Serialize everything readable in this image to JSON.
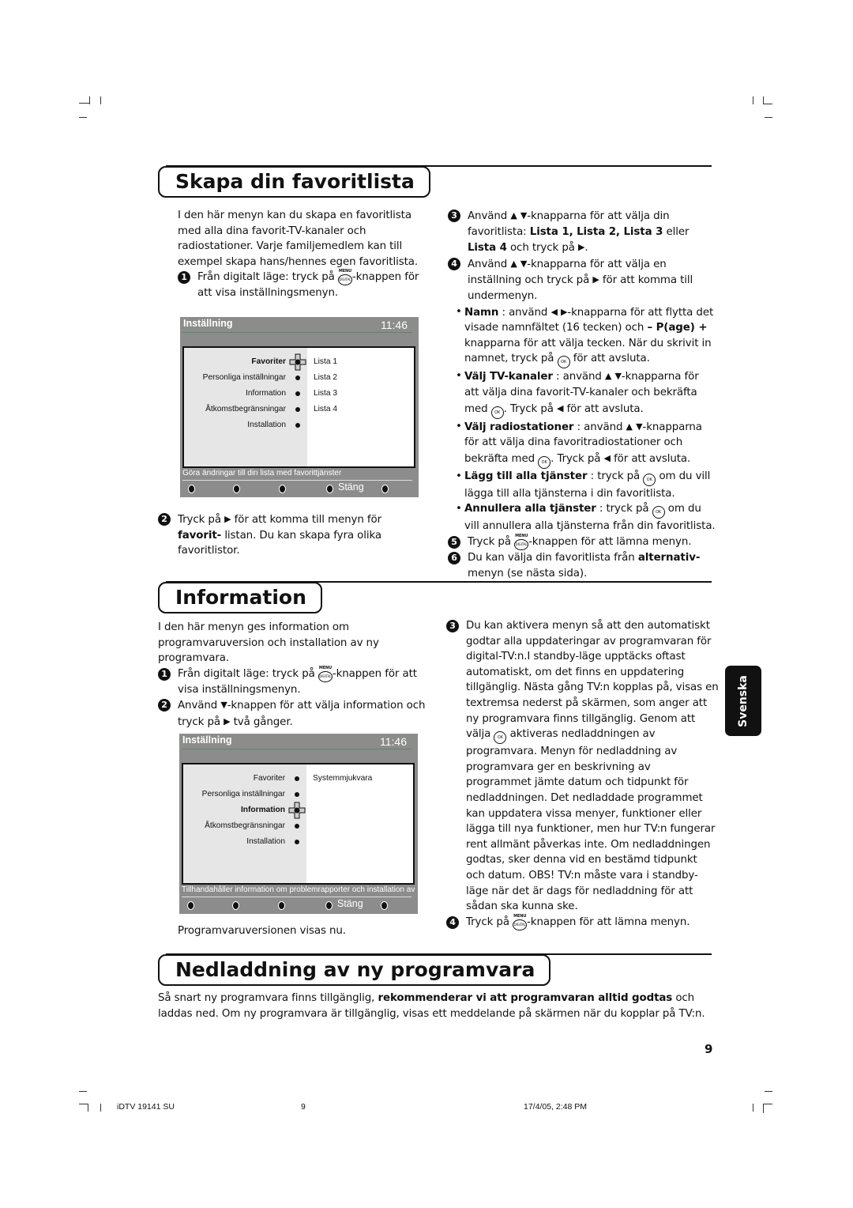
{
  "sections": {
    "favorites": {
      "title": "Skapa din favoritlista"
    },
    "information": {
      "title": "Information"
    },
    "download": {
      "title": "Nedladdning av ny programvara"
    }
  },
  "fav_left": [
    {
      "type": "p",
      "segs": [
        "I den här menyn kan du skapa en favoritlista med alla dina favorit-TV-kanaler och radiostationer. Varje familjemedlem kan till exempel skapa hans/hennes egen favoritlista."
      ]
    },
    {
      "type": "step",
      "n": "1",
      "segs": [
        "Från digitalt läge: tryck på ",
        {
          "i": "menu"
        },
        "-knappen för att visa inställningsmenyn."
      ]
    }
  ],
  "fav_left2": [
    {
      "type": "step",
      "n": "2",
      "segs": [
        "Tryck på ",
        {
          "i": "right"
        },
        " för att komma till menyn för ",
        {
          "b": "favorit-"
        },
        " listan. Du kan skapa fyra olika favoritlistor."
      ]
    }
  ],
  "fav_right": [
    {
      "type": "step",
      "n": "3",
      "segs": [
        "Använd ",
        {
          "i": "up"
        },
        " ",
        {
          "i": "down"
        },
        "-knapparna för att välja din favoritlista: ",
        {
          "b": "Lista 1, Lista 2, Lista 3"
        },
        " eller ",
        {
          "b": "Lista 4"
        },
        " och tryck på ",
        {
          "i": "right"
        },
        "."
      ]
    },
    {
      "type": "step",
      "n": "4",
      "segs": [
        "Använd ",
        {
          "i": "up"
        },
        " ",
        {
          "i": "down"
        },
        "-knapparna för att välja en inställning och tryck på ",
        {
          "i": "right"
        },
        " för att komma till undermenyn."
      ]
    },
    {
      "type": "bul",
      "segs": [
        {
          "b": "Namn"
        },
        " : använd ",
        {
          "i": "left"
        },
        " ",
        {
          "i": "right"
        },
        "-knapparna för att flytta det visade namnfältet (16 tecken) och ",
        {
          "b": "– P(age) +"
        },
        " knapparna för att välja tecken. När du skrivit in namnet, tryck på ",
        {
          "i": "ok"
        },
        " för att avsluta."
      ]
    },
    {
      "type": "bul",
      "segs": [
        {
          "b": "Välj TV-kanaler"
        },
        " : använd ",
        {
          "i": "up"
        },
        " ",
        {
          "i": "down"
        },
        "-knapparna för att välja dina favorit-TV-kanaler och bekräfta med ",
        {
          "i": "ok"
        },
        ". Tryck på ",
        {
          "i": "left"
        },
        " för att avsluta."
      ]
    },
    {
      "type": "bul",
      "segs": [
        {
          "b": "Välj radiostationer"
        },
        " : använd ",
        {
          "i": "up"
        },
        " ",
        {
          "i": "down"
        },
        "-knapparna för att välja dina favoritradiostationer och bekräfta med ",
        {
          "i": "ok"
        },
        ". Tryck på ",
        {
          "i": "left"
        },
        " för att avsluta."
      ]
    },
    {
      "type": "bul",
      "segs": [
        {
          "b": "Lägg till alla tjänster"
        },
        " : tryck på ",
        {
          "i": "ok"
        },
        " om du vill lägga till alla tjänsterna i din favoritlista."
      ]
    },
    {
      "type": "bul",
      "segs": [
        {
          "b": "Annullera alla tjänster"
        },
        " : tryck på ",
        {
          "i": "ok"
        },
        " om du vill annullera alla tjänsterna från din favoritlista."
      ]
    },
    {
      "type": "step",
      "n": "5",
      "segs": [
        "Tryck på ",
        {
          "i": "menu"
        },
        "-knappen för att lämna menyn."
      ]
    },
    {
      "type": "step",
      "n": "6",
      "segs": [
        "Du kan välja din favoritlista från ",
        {
          "b": "alternativ-"
        },
        " menyn (se nästa sida)."
      ]
    }
  ],
  "info_left": [
    {
      "type": "p",
      "segs": [
        "I den här menyn ges information om programvaruversion och installation av ny programvara."
      ]
    },
    {
      "type": "step",
      "n": "1",
      "segs": [
        "Från digitalt läge: tryck på ",
        {
          "i": "menu"
        },
        "-knappen för att visa inställningsmenyn."
      ]
    },
    {
      "type": "step",
      "n": "2",
      "segs": [
        "Använd ",
        {
          "i": "down"
        },
        "-knappen för att välja information och tryck på ",
        {
          "i": "right"
        },
        " två gånger."
      ]
    }
  ],
  "info_after": "Programvaruversionen visas nu.",
  "info_right": [
    {
      "type": "step",
      "n": "3",
      "segs": [
        "Du kan aktivera menyn så att den automatiskt godtar alla uppdateringar av programvaran för digital-TV:n.I standby-läge upptäcks oftast automatiskt, om det finns en uppdatering tillgänglig. Nästa gång TV:n kopplas på, visas en textremsa nederst på skärmen, som anger att ny programvara finns tillgänglig. Genom att välja ",
        {
          "i": "ok"
        },
        " aktiveras nedladdningen av programvara. Menyn för nedladdning av programvara ger en beskrivning av programmet jämte datum och tidpunkt för nedladdningen. Det nedladdade programmet kan uppdatera vissa menyer, funktioner eller lägga till nya funktioner, men hur TV:n fungerar rent allmänt påverkas inte. Om nedladdningen godtas, sker denna vid en bestämd tidpunkt och datum. OBS! TV:n måste vara i standby-läge när det är dags för nedladdning för att sådan ska kunna ske."
      ]
    },
    {
      "type": "step",
      "n": "4",
      "segs": [
        "Tryck på ",
        {
          "i": "menu"
        },
        "-knappen för att lämna menyn."
      ]
    }
  ],
  "download_text": [
    {
      "type": "p",
      "segs": [
        "Så snart ny programvara finns tillgänglig, ",
        {
          "b": "rekommenderar vi att programvaran alltid godtas"
        },
        " och laddas ned. Om ny programvara är tillgänglig, visas ett meddelande på skärmen när du kopplar på TV:n."
      ]
    }
  ],
  "icons": {
    "menu_top": "MENU",
    "menu_body": "DIGITAL",
    "ok": "OK"
  },
  "menu1": {
    "header": "Inställning",
    "time": "11:46",
    "items": [
      {
        "label": "Favoriter",
        "selected": true
      },
      {
        "label": "Personliga inställningar"
      },
      {
        "label": "Information"
      },
      {
        "label": "Åtkomstbegränsningar"
      },
      {
        "label": "Installation"
      }
    ],
    "right": [
      "Lista 1",
      "Lista 2",
      "Lista 3",
      "Lista 4"
    ],
    "status": "Göra ändringar till din lista med favorittjänster",
    "close": "Stäng"
  },
  "menu2": {
    "header": "Inställning",
    "time": "11:46",
    "items": [
      {
        "label": "Favoriter"
      },
      {
        "label": "Personliga inställningar"
      },
      {
        "label": "Information",
        "selected": true
      },
      {
        "label": "Åtkomstbegränsningar"
      },
      {
        "label": "Installation"
      }
    ],
    "right": [
      "Systemmjukvara"
    ],
    "status": "Tillhandahåller information om problemrapporter och installation av ny",
    "close": "Stäng"
  },
  "page_number": "9",
  "language_tab": "Svenska",
  "footer": {
    "doc": "iDTV 19141 SU",
    "page": "9",
    "date": "17/4/05, 2:48 PM"
  },
  "colors": {
    "menu_bg": "#8c8c8c",
    "menu_left": "#e6e6e6",
    "tab_bg": "#111111"
  }
}
